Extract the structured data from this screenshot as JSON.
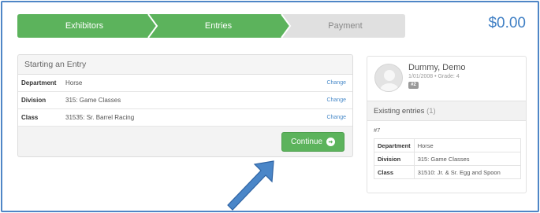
{
  "steps": [
    {
      "label": "Exhibitors",
      "state": "done"
    },
    {
      "label": "Entries",
      "state": "done"
    },
    {
      "label": "Payment",
      "state": "todo"
    }
  ],
  "total": "$0.00",
  "entry_form": {
    "title": "Starting an Entry",
    "rows": [
      {
        "label": "Department",
        "value": "Horse",
        "action": "Change"
      },
      {
        "label": "Division",
        "value": "315: Game Classes",
        "action": "Change"
      },
      {
        "label": "Class",
        "value": "31535: Sr. Barrel Racing",
        "action": "Change"
      }
    ],
    "continue_label": "Continue"
  },
  "exhibitor": {
    "name": "Dummy, Demo",
    "details": "1/01/2008 • Grade: 4",
    "badge": "#2",
    "existing_label": "Existing entries",
    "existing_count": "(1)",
    "entry": {
      "id": "#7",
      "rows": [
        {
          "label": "Department",
          "value": "Horse"
        },
        {
          "label": "Division",
          "value": "315: Game Classes"
        },
        {
          "label": "Class",
          "value": "31510: Jr. & Sr. Egg and Spoon"
        }
      ]
    }
  },
  "colors": {
    "step_done": "#5cb35c",
    "step_todo": "#e0e0e0",
    "accent": "#3f7fc4",
    "button": "#5cb35c",
    "annotation_arrow": "#4a86c8"
  },
  "icons": {
    "continue": "arrow-circle-right-icon",
    "avatar": "user-silhouette-icon",
    "annotation": "pointer-arrow"
  }
}
